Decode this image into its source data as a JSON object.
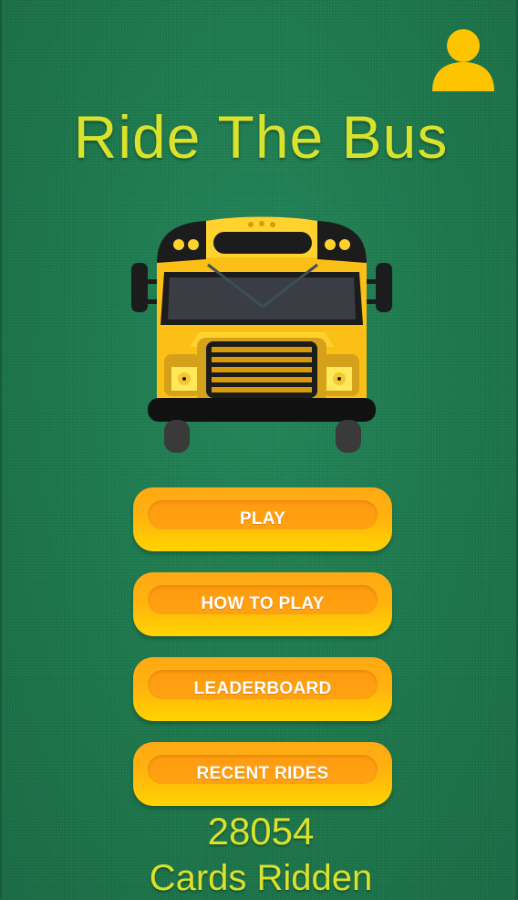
{
  "app": {
    "title": "Ride The Bus"
  },
  "menu": {
    "play_label": "PLAY",
    "how_to_play_label": "HOW TO PLAY",
    "leaderboard_label": "LEADERBOARD",
    "recent_rides_label": "RECENT RIDES"
  },
  "stats": {
    "cards_ridden_count": "28054",
    "cards_ridden_label": "Cards Ridden"
  },
  "icons": {
    "profile": "user-icon",
    "hero": "school-bus-illustration"
  },
  "colors": {
    "background": "#1f7a4e",
    "title_text": "#d9e22d",
    "button_gradient_top": "#ffa914",
    "button_gradient_bottom": "#ffd400",
    "button_text": "#ffffff",
    "bus_yellow": "#fbbf16",
    "profile_icon": "#ffc400"
  }
}
